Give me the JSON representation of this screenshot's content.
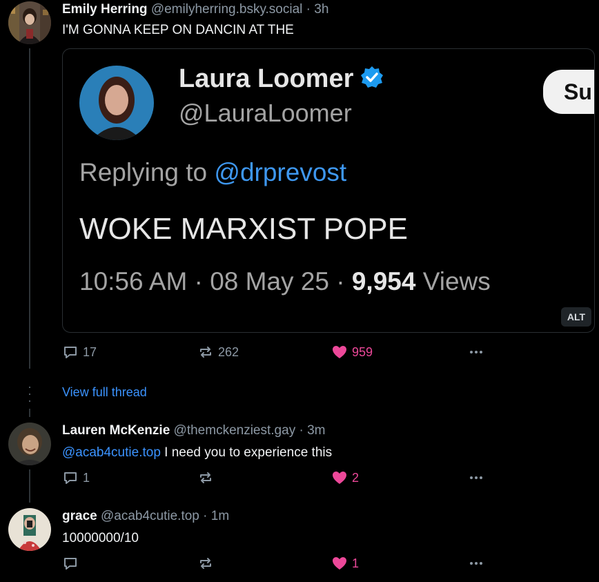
{
  "posts": [
    {
      "name": "Emily Herring",
      "handle": "@emilyherring.bsky.social",
      "sep": "·",
      "time": "3h",
      "text": "I'M GONNA KEEP ON DANCIN AT THE",
      "embed": {
        "name": "Laura Loomer",
        "handle": "@LauraLoomer",
        "subscribe_label": "Su",
        "reply_prefix": "Replying to ",
        "reply_mention": "@drprevost",
        "body": "WOKE MARXIST POPE",
        "meta_time": "10:56 AM · 08 May 25 · ",
        "meta_views_count": "9,954",
        "meta_views_label": " Views",
        "alt_label": "ALT"
      },
      "replies": "17",
      "reposts": "262",
      "likes": "959",
      "view_thread": "View full thread"
    },
    {
      "name": "Lauren McKenzie",
      "handle": "@themckenziest.gay",
      "sep": "·",
      "time": "3m",
      "mention": "@acab4cutie.top",
      "text": " I need you to experience this",
      "replies": "1",
      "reposts": "",
      "likes": "2"
    },
    {
      "name": "grace",
      "handle": "@acab4cutie.top",
      "sep": "·",
      "time": "1m",
      "text": "10000000/10",
      "replies": "",
      "reposts": "",
      "likes": "1"
    }
  ],
  "icons": {
    "reply": "speech-bubble-icon",
    "repost": "repost-arrows-icon",
    "like": "heart-icon",
    "more": "ellipsis-icon",
    "verified": "verified-badge-icon"
  },
  "colors": {
    "background": "#000000",
    "link": "#3b93ff",
    "like": "#ec4899",
    "muted": "#8d99a5"
  }
}
